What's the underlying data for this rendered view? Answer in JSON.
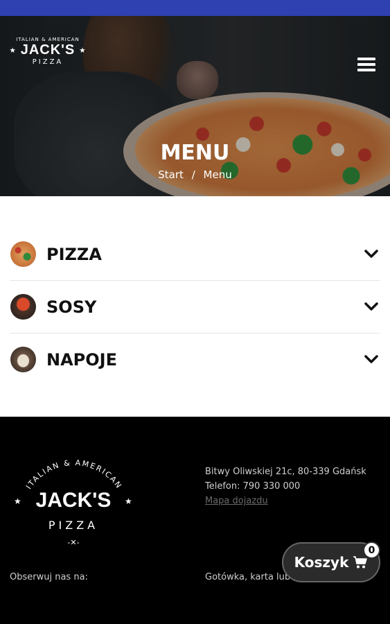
{
  "header": {
    "logo": {
      "top_arc": "ITALIAN & AMERICAN",
      "brand": "JACK'S",
      "sub": "PIZZA"
    },
    "hero_title": "MENU",
    "breadcrumb": {
      "home": "Start",
      "separator": "/",
      "current": "Menu"
    }
  },
  "categories": [
    {
      "label": "PIZZA",
      "icon": "pizza-thumbnail"
    },
    {
      "label": "SOSY",
      "icon": "sauce-thumbnail"
    },
    {
      "label": "NAPOJE",
      "icon": "drinks-thumbnail"
    }
  ],
  "footer": {
    "logo": {
      "top_arc": "ITALIAN & AMERICAN",
      "brand": "JACK'S",
      "sub": "PIZZA"
    },
    "address": "Bitwy Oliwskiej 21c, 80-339 Gdańsk",
    "phone": "Telefon: 790 330 000",
    "map_link": "Mapa dojazdu",
    "follow": "Obserwuj nas na:",
    "payment": "Gotówka, karta lub"
  },
  "cart": {
    "label": "Koszyk",
    "count": "0"
  },
  "colors": {
    "status_bar": "#2f40b0",
    "footer_bg": "#000000",
    "cart_bg": "#2b2b2b"
  }
}
